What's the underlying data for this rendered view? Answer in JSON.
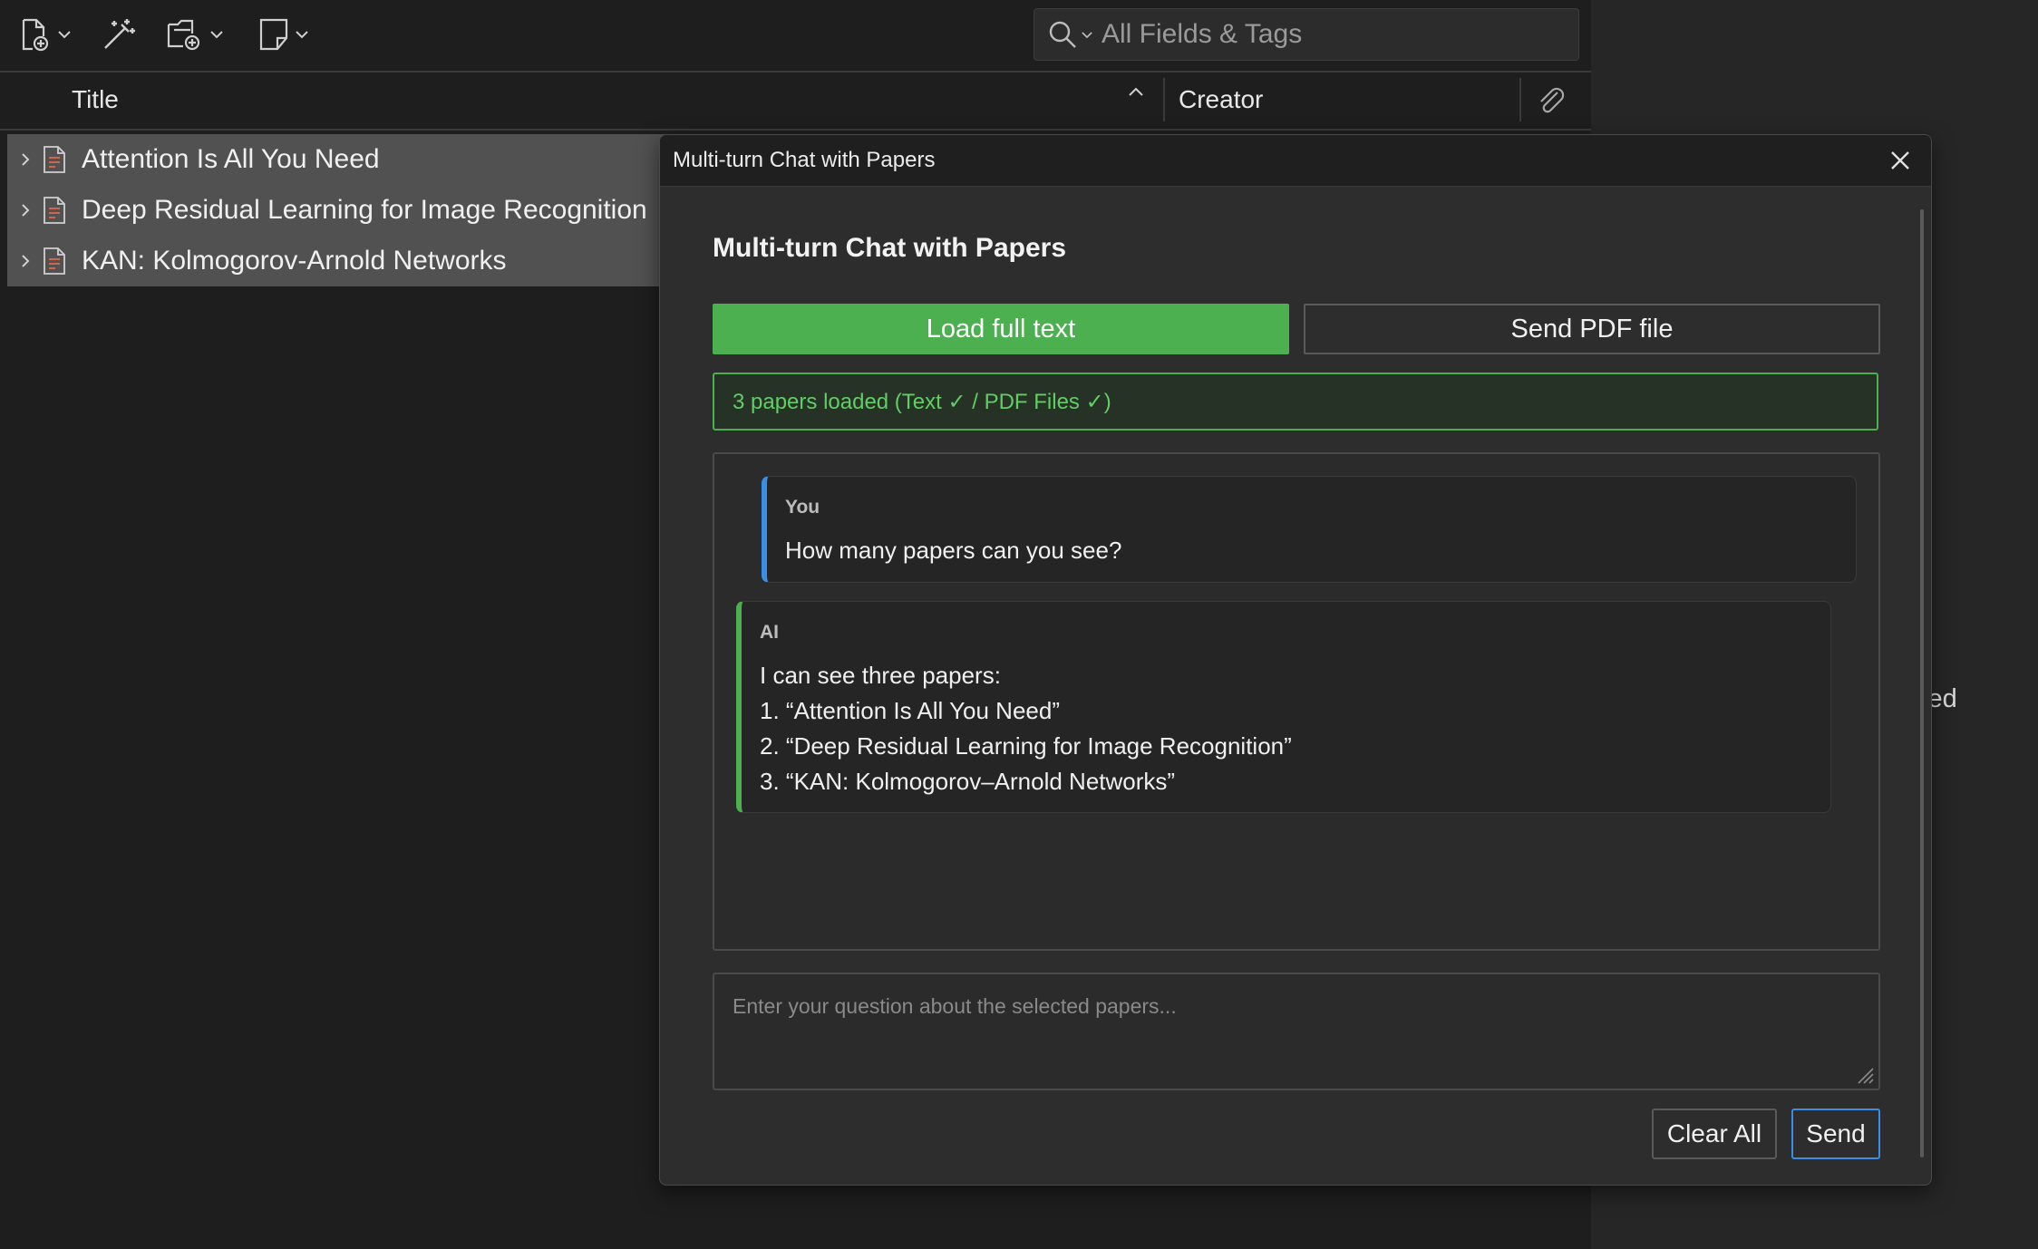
{
  "toolbar": {
    "search": {
      "placeholder": "All Fields & Tags",
      "value": ""
    }
  },
  "columns": {
    "title": "Title",
    "creator": "Creator"
  },
  "items": [
    {
      "title": "Attention Is All You Need"
    },
    {
      "title": "Deep Residual Learning for Image Recognition"
    },
    {
      "title": "KAN: Kolmogorov-Arnold Networks"
    }
  ],
  "right_pane": {
    "partial_text": "cted"
  },
  "dialog": {
    "window_title": "Multi-turn Chat with Papers",
    "heading": "Multi-turn Chat with Papers",
    "load_full_text_label": "Load full text",
    "send_pdf_label": "Send PDF file",
    "status": "3 papers loaded (Text ✓ / PDF Files ✓)",
    "messages": [
      {
        "sender": "You",
        "lines": [
          "How many papers can you see?"
        ]
      },
      {
        "sender": "AI",
        "lines": [
          "I can see three papers:",
          "1. “Attention Is All You Need”",
          "2. “Deep Residual Learning for Image Recognition”",
          "3. “KAN: Kolmogorov–Arnold Networks”"
        ]
      }
    ],
    "question_placeholder": "Enter your question about the selected papers...",
    "clear_all_label": "Clear All",
    "send_label": "Send"
  },
  "colors": {
    "accent_green": "#4caf50",
    "accent_blue": "#3a8ee6",
    "status_text": "#5fcf63",
    "background": "#1e1e1e"
  },
  "icons": [
    "new-item-icon",
    "magic-wand-icon",
    "add-attachment-icon",
    "new-note-icon",
    "search-icon",
    "sort-ascending-icon",
    "attachment-icon",
    "chevron-right-icon",
    "document-icon",
    "close-icon",
    "resize-grip-icon"
  ]
}
